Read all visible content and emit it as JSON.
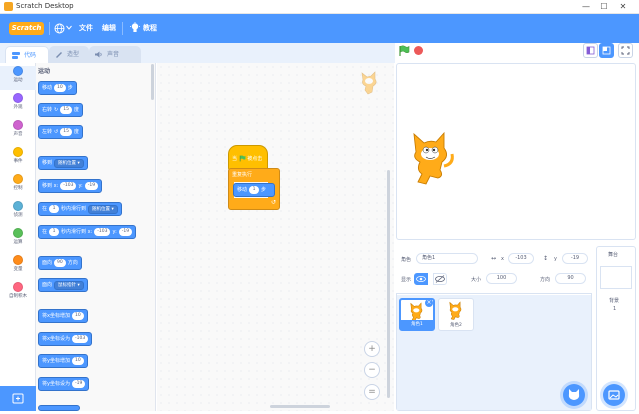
{
  "window": {
    "title": "Scratch Desktop",
    "controls": [
      "—",
      "☐",
      "✕"
    ]
  },
  "menubar": {
    "logo": "Scratch",
    "file": "文件",
    "edit": "编辑",
    "tutorials": "教程"
  },
  "tabs": {
    "code": "代码",
    "costumes": "造型",
    "sounds": "声音"
  },
  "categories": [
    {
      "label": "运动",
      "color": "#4c97ff"
    },
    {
      "label": "外观",
      "color": "#9966ff"
    },
    {
      "label": "声音",
      "color": "#cf63cf"
    },
    {
      "label": "事件",
      "color": "#ffbf00"
    },
    {
      "label": "控制",
      "color": "#ffab19"
    },
    {
      "label": "侦测",
      "color": "#5cb1d6"
    },
    {
      "label": "运算",
      "color": "#59c059"
    },
    {
      "label": "变量",
      "color": "#ff8c1a"
    },
    {
      "label": "自制积木",
      "color": "#ff6680"
    }
  ],
  "palette": {
    "section_title": "运动",
    "blocks": {
      "move_prefix": "移动",
      "move_val": "10",
      "move_suffix": "步",
      "turn_r_prefix": "右转",
      "turn_r_val": "15",
      "turn_r_suffix": "度",
      "turn_l_prefix": "左转",
      "turn_l_val": "15",
      "turn_l_suffix": "度",
      "goto_prefix": "移到",
      "goto_drop": "随机位置",
      "gotoxy_prefix": "移到 x:",
      "gotoxy_x": "-103",
      "gotoxy_ylabel": "y:",
      "gotoxy_y": "-19",
      "glide_prefix": "在",
      "glide_val": "1",
      "glide_mid": "秒内滑行到",
      "glide_drop": "随机位置",
      "glidexy_prefix": "在",
      "glidexy_val": "1",
      "glidexy_mid": "秒内滑行到 x:",
      "glidexy_x": "-103",
      "glidexy_ylabel": "y:",
      "glidexy_y": "-19",
      "point_prefix": "面向",
      "point_val": "90",
      "point_suffix": "方向",
      "pointto_prefix": "面向",
      "pointto_drop": "鼠标指针",
      "changex_label": "将x坐标增加",
      "changex_val": "10",
      "setx_label": "将x坐标设为",
      "setx_val": "-103",
      "changey_label": "将y坐标增加",
      "changey_val": "10",
      "sety_label": "将y坐标设为",
      "sety_val": "-19"
    }
  },
  "script": {
    "hat_prefix": "当",
    "hat_suffix": "被点击",
    "forever": "重复执行",
    "move_prefix": "移动",
    "move_val": "1",
    "move_suffix": "步"
  },
  "zoom": {
    "in": "+",
    "out": "−",
    "reset": "="
  },
  "sprite_info": {
    "sprite_label": "角色",
    "sprite_name": "角色1",
    "x_label": "x",
    "x_value": "-103",
    "y_label": "y",
    "y_value": "-19",
    "show_label": "显示",
    "size_label": "大小",
    "size_value": "100",
    "direction_label": "方向",
    "direction_value": "90"
  },
  "sprites": [
    {
      "name": "角色1",
      "selected": true
    },
    {
      "name": "角色2",
      "selected": false
    }
  ],
  "stage_pane": {
    "title": "舞台",
    "backdrops_label": "背景",
    "backdrops_count": "1"
  },
  "icons": [
    "globe-icon",
    "flag-icon",
    "stop-icon",
    "cat-sprite",
    "lightbulb-icon"
  ]
}
